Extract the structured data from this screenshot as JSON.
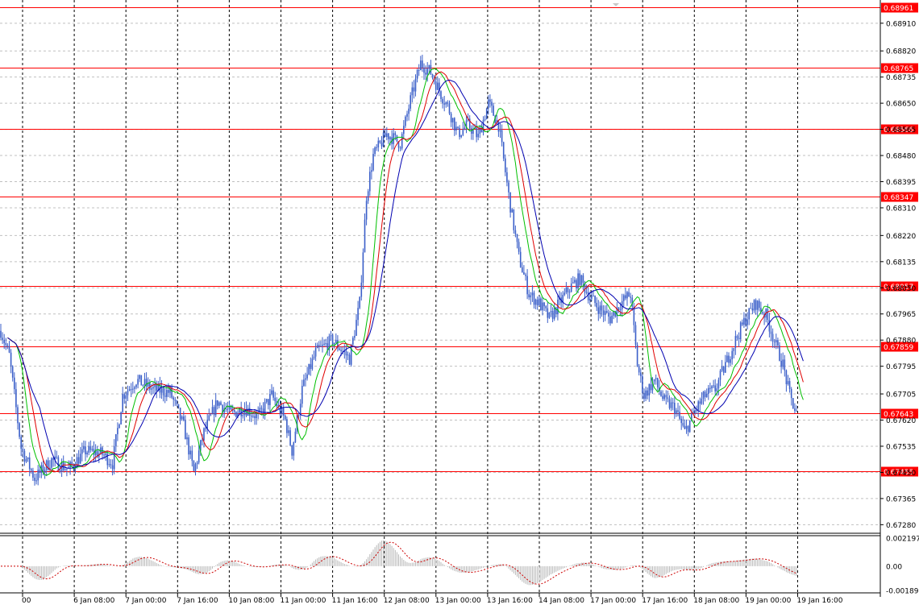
{
  "chart_data": {
    "type": "candlestick",
    "x_ticks": [
      "00",
      "6 Jan 08:00",
      "7 Jan 00:00",
      "7 Jan 16:00",
      "10 Jan 08:00",
      "11 Jan 00:00",
      "11 Jan 16:00",
      "12 Jan 08:00",
      "13 Jan 00:00",
      "13 Jan 16:00",
      "14 Jan 08:00",
      "17 Jan 00:00",
      "17 Jan 16:00",
      "18 Jan 08:00",
      "19 Jan 00:00",
      "19 Jan 16:00"
    ],
    "y_ticks": [
      "0.68910",
      "0.68820",
      "0.68735",
      "0.68650",
      "0.68565",
      "0.68480",
      "0.68395",
      "0.68310",
      "0.68220",
      "0.68135",
      "0.68050",
      "0.67965",
      "0.67880",
      "0.67795",
      "0.67705",
      "0.67620",
      "0.67535",
      "0.67450",
      "0.67365",
      "0.67280"
    ],
    "ylim": [
      0.6726,
      0.68975
    ],
    "levels": [
      {
        "label": "0.68961",
        "value": 0.68961
      },
      {
        "label": "0.68765",
        "value": 0.68765
      },
      {
        "label": "0.68566",
        "value": 0.68566
      },
      {
        "label": "0.68347",
        "value": 0.68347
      },
      {
        "label": "0.68057",
        "value": 0.68057
      },
      {
        "label": "0.67859",
        "value": 0.67859
      },
      {
        "label": "0.67643",
        "value": 0.67643
      },
      {
        "label": "0.67455",
        "value": 0.67455
      }
    ],
    "level_color": "#ff0000",
    "candle_color": "#3b5fc9",
    "ma_colors": [
      "#00c000",
      "#e00000",
      "#0000b0"
    ],
    "price_anchors": [
      [
        0,
        0.6791
      ],
      [
        5,
        0.6783
      ],
      [
        12,
        0.6753
      ],
      [
        20,
        0.6743
      ],
      [
        30,
        0.6749
      ],
      [
        40,
        0.6746
      ],
      [
        50,
        0.6752
      ],
      [
        60,
        0.6751
      ],
      [
        66,
        0.6748
      ],
      [
        72,
        0.677
      ],
      [
        80,
        0.6775
      ],
      [
        90,
        0.6772
      ],
      [
        100,
        0.6771
      ],
      [
        108,
        0.676
      ],
      [
        114,
        0.6745
      ],
      [
        120,
        0.6758
      ],
      [
        128,
        0.6768
      ],
      [
        136,
        0.6764
      ],
      [
        144,
        0.6766
      ],
      [
        152,
        0.6763
      ],
      [
        160,
        0.677
      ],
      [
        168,
        0.6762
      ],
      [
        172,
        0.6752
      ],
      [
        178,
        0.6772
      ],
      [
        186,
        0.6784
      ],
      [
        196,
        0.6788
      ],
      [
        206,
        0.6782
      ],
      [
        212,
        0.68
      ],
      [
        216,
        0.6835
      ],
      [
        220,
        0.6848
      ],
      [
        228,
        0.6855
      ],
      [
        236,
        0.6852
      ],
      [
        242,
        0.6866
      ],
      [
        248,
        0.6878
      ],
      [
        254,
        0.6875
      ],
      [
        260,
        0.6868
      ],
      [
        264,
        0.6864
      ],
      [
        270,
        0.6855
      ],
      [
        276,
        0.6858
      ],
      [
        282,
        0.6854
      ],
      [
        288,
        0.6865
      ],
      [
        294,
        0.6858
      ],
      [
        300,
        0.6835
      ],
      [
        306,
        0.6815
      ],
      [
        312,
        0.6803
      ],
      [
        318,
        0.68
      ],
      [
        324,
        0.6795
      ],
      [
        330,
        0.68
      ],
      [
        336,
        0.6805
      ],
      [
        342,
        0.6808
      ],
      [
        348,
        0.6802
      ],
      [
        354,
        0.6798
      ],
      [
        360,
        0.6795
      ],
      [
        366,
        0.68
      ],
      [
        372,
        0.6803
      ],
      [
        376,
        0.678
      ],
      [
        380,
        0.677
      ],
      [
        386,
        0.6775
      ],
      [
        392,
        0.6768
      ],
      [
        398,
        0.6766
      ],
      [
        404,
        0.6758
      ],
      [
        410,
        0.6765
      ],
      [
        416,
        0.677
      ],
      [
        422,
        0.6772
      ],
      [
        428,
        0.678
      ],
      [
        434,
        0.6788
      ],
      [
        440,
        0.6795
      ],
      [
        446,
        0.68
      ],
      [
        452,
        0.6796
      ],
      [
        458,
        0.6786
      ],
      [
        462,
        0.678
      ],
      [
        466,
        0.677
      ],
      [
        470,
        0.6764
      ]
    ],
    "oscillator": {
      "y_ticks": [
        "0.002197",
        "0.00",
        "-0.001898"
      ],
      "ylim": [
        -0.001898,
        0.002197
      ]
    }
  }
}
